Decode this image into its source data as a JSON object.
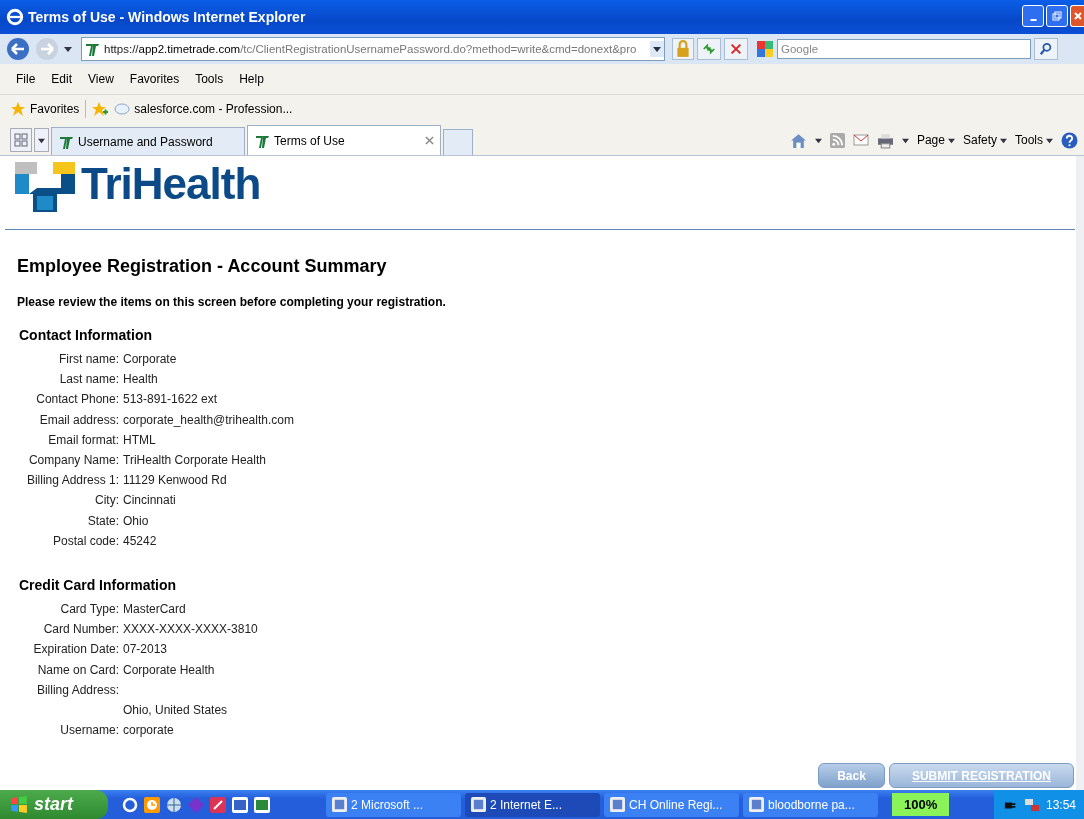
{
  "window": {
    "title": "Terms of Use - Windows Internet Explorer"
  },
  "address": {
    "prefix": "https://",
    "host": "app2.timetrade.com",
    "path": "/tc/ClientRegistrationUsernamePassword.do?method=write&cmd=donext&pro"
  },
  "search": {
    "placeholder": "Google"
  },
  "menu": [
    "File",
    "Edit",
    "View",
    "Favorites",
    "Tools",
    "Help"
  ],
  "favorites": {
    "label": "Favorites",
    "links": [
      "salesforce.com - Profession..."
    ]
  },
  "tabs": [
    {
      "label": "Username and Password",
      "selected": false
    },
    {
      "label": "Terms of Use",
      "selected": true
    }
  ],
  "command_bar": [
    "Page",
    "Safety",
    "Tools"
  ],
  "page": {
    "logo": "TriHealth",
    "heading": "Employee Registration - Account Summary",
    "intro": "Please review the items on this screen before completing your registration.",
    "sections": [
      {
        "title": "Contact Information",
        "rows": [
          {
            "label": "First name:",
            "value": "Corporate"
          },
          {
            "label": "Last name:",
            "value": "Health"
          },
          {
            "label": "Contact Phone:",
            "value": "513-891-1622 ext"
          },
          {
            "label": "Email address:",
            "value": "corporate_health@trihealth.com"
          },
          {
            "label": "Email format:",
            "value": "HTML"
          },
          {
            "label": "Company Name:",
            "value": "TriHealth Corporate Health"
          },
          {
            "label": "Billing Address 1:",
            "value": "11129 Kenwood Rd"
          },
          {
            "label": "City:",
            "value": "Cincinnati"
          },
          {
            "label": "State:",
            "value": "Ohio"
          },
          {
            "label": "Postal code:",
            "value": "45242"
          }
        ]
      },
      {
        "title": "Credit Card Information",
        "rows": [
          {
            "label": "Card Type:",
            "value": "MasterCard"
          },
          {
            "label": "Card Number:",
            "value": "XXXX-XXXX-XXXX-3810"
          },
          {
            "label": "Expiration Date:",
            "value": "07-2013"
          },
          {
            "label": "Name on Card:",
            "value": "Corporate Health"
          },
          {
            "label": "Billing Address:"
          },
          {
            "value": "Ohio, United States"
          },
          {
            "label": "Username:",
            "value": "corporate"
          }
        ]
      }
    ],
    "buttons": [
      {
        "label": "Back",
        "kind": "plain"
      },
      {
        "label": "SUBMIT REGISTRATION",
        "kind": "link"
      }
    ]
  },
  "taskbar": {
    "start": "start",
    "items": [
      {
        "label": "2 Microsoft ...",
        "selected": false
      },
      {
        "label": "2 Internet E...",
        "selected": true
      },
      {
        "label": "CH Online Regi...",
        "selected": false
      },
      {
        "label": "bloodborne pa...",
        "selected": false
      }
    ],
    "battery": "100%",
    "clock": "13:54"
  }
}
